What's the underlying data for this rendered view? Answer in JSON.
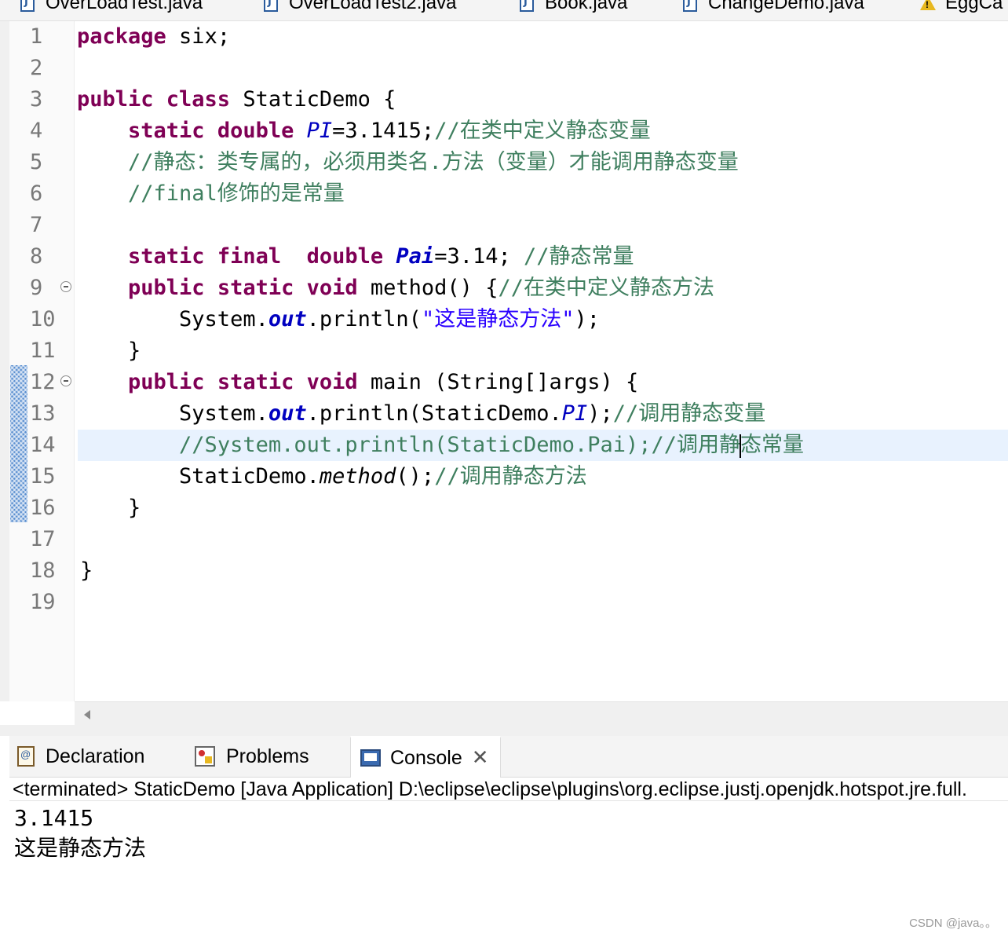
{
  "editor_tabs": [
    {
      "label": "OverLoadTest.java",
      "icon": "java-file-icon"
    },
    {
      "label": "OverLoadTest2.java",
      "icon": "java-file-icon"
    },
    {
      "label": "Book.java",
      "icon": "java-file-icon"
    },
    {
      "label": "ChangeDemo.java",
      "icon": "java-file-icon"
    },
    {
      "label": "EggCa",
      "icon": "java-file-warning-icon"
    }
  ],
  "code": {
    "line_numbers": [
      "1",
      "2",
      "3",
      "4",
      "5",
      "6",
      "7",
      "8",
      "9",
      "10",
      "11",
      "12",
      "13",
      "14",
      "15",
      "16",
      "17",
      "18",
      "19"
    ],
    "current_line": "14",
    "tokens": {
      "l1_kw": "package",
      "l1_rest": " six;",
      "l3_kw": "public class",
      "l3_rest": " StaticDemo {",
      "l4_indent": "    ",
      "l4_kw": "static double",
      "l4_sp": " ",
      "l4_fld": "PI",
      "l4_val": "=3.1415;",
      "l4_cm": "//在类中定义静态变量",
      "l5_cm": "    //静态：类专属的，必须用类名.方法（变量）才能调用静态变量",
      "l6_cm": "    //final修饰的是常量",
      "l8_indent": "    ",
      "l8_kw": "static final  double",
      "l8_sp": " ",
      "l8_fld": "Pai",
      "l8_val": "=3.14; ",
      "l8_cm": "//静态常量",
      "l9_indent": "    ",
      "l9_kw": "public static void",
      "l9_rest": " method() {",
      "l9_cm": "//在类中定义静态方法",
      "l10_pre": "        System.",
      "l10_fld": "out",
      "l10_mid": ".println(",
      "l10_str": "\"这是静态方法\"",
      "l10_end": ");",
      "l11": "    }",
      "l12_indent": "    ",
      "l12_kw": "public static void",
      "l12_rest": " main (String[]args) {",
      "l13_pre": "        System.",
      "l13_fld": "out",
      "l13_mid": ".println(StaticDemo.",
      "l13_fld2": "PI",
      "l13_end": ");",
      "l13_cm": "//调用静态变量",
      "l14_indent": "        ",
      "l14_cm_a": "//System.out.println(StaticDemo.Pai);//调用静",
      "l14_cm_b": "态常量",
      "l15_pre": "        StaticDemo.",
      "l15_mth": "method",
      "l15_end": "();",
      "l15_cm": "//调用静态方法",
      "l16": "    }",
      "l18": "}"
    }
  },
  "view_tabs": [
    {
      "label": "Declaration",
      "icon": "declaration-icon"
    },
    {
      "label": "Problems",
      "icon": "problems-icon"
    },
    {
      "label": "Console",
      "icon": "console-icon",
      "active": true
    }
  ],
  "console": {
    "header": "<terminated> StaticDemo [Java Application] D:\\eclipse\\eclipse\\plugins\\org.eclipse.justj.openjdk.hotspot.jre.full.",
    "output": [
      "3.1415",
      "这是静态方法"
    ]
  },
  "watermark": "CSDN @java。。",
  "colors": {
    "keyword": "#7f0055",
    "comment": "#3f7f5f",
    "string": "#2a00ff",
    "field": "#0000c0",
    "current_line": "#e8f2fe",
    "change_marker": "#5a8fd0"
  }
}
